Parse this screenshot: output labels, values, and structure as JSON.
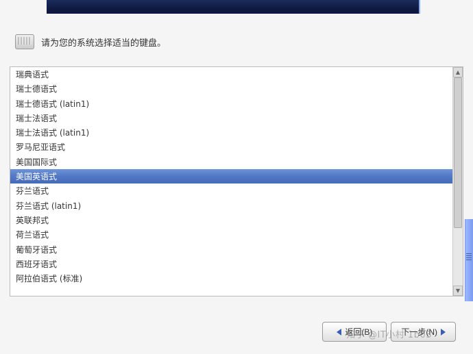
{
  "prompt": "请为您的系统选择适当的键盘。",
  "keyboard_list": {
    "items": [
      {
        "label": "瑞典语式",
        "selected": false
      },
      {
        "label": "瑞士德语式",
        "selected": false
      },
      {
        "label": "瑞士德语式 (latin1)",
        "selected": false
      },
      {
        "label": "瑞士法语式",
        "selected": false
      },
      {
        "label": "瑞士法语式 (latin1)",
        "selected": false
      },
      {
        "label": "罗马尼亚语式",
        "selected": false
      },
      {
        "label": "美国国际式",
        "selected": false
      },
      {
        "label": "美国英语式",
        "selected": true
      },
      {
        "label": "芬兰语式",
        "selected": false
      },
      {
        "label": "芬兰语式 (latin1)",
        "selected": false
      },
      {
        "label": "英联邦式",
        "selected": false
      },
      {
        "label": "荷兰语式",
        "selected": false
      },
      {
        "label": "葡萄牙语式",
        "selected": false
      },
      {
        "label": "西班牙语式",
        "selected": false
      },
      {
        "label": "阿拉伯语式 (标准)",
        "selected": false
      }
    ]
  },
  "buttons": {
    "back_label": "返回(B)",
    "next_label": "下一步(N)"
  },
  "watermark": "知乎 @IT小村 1b03"
}
